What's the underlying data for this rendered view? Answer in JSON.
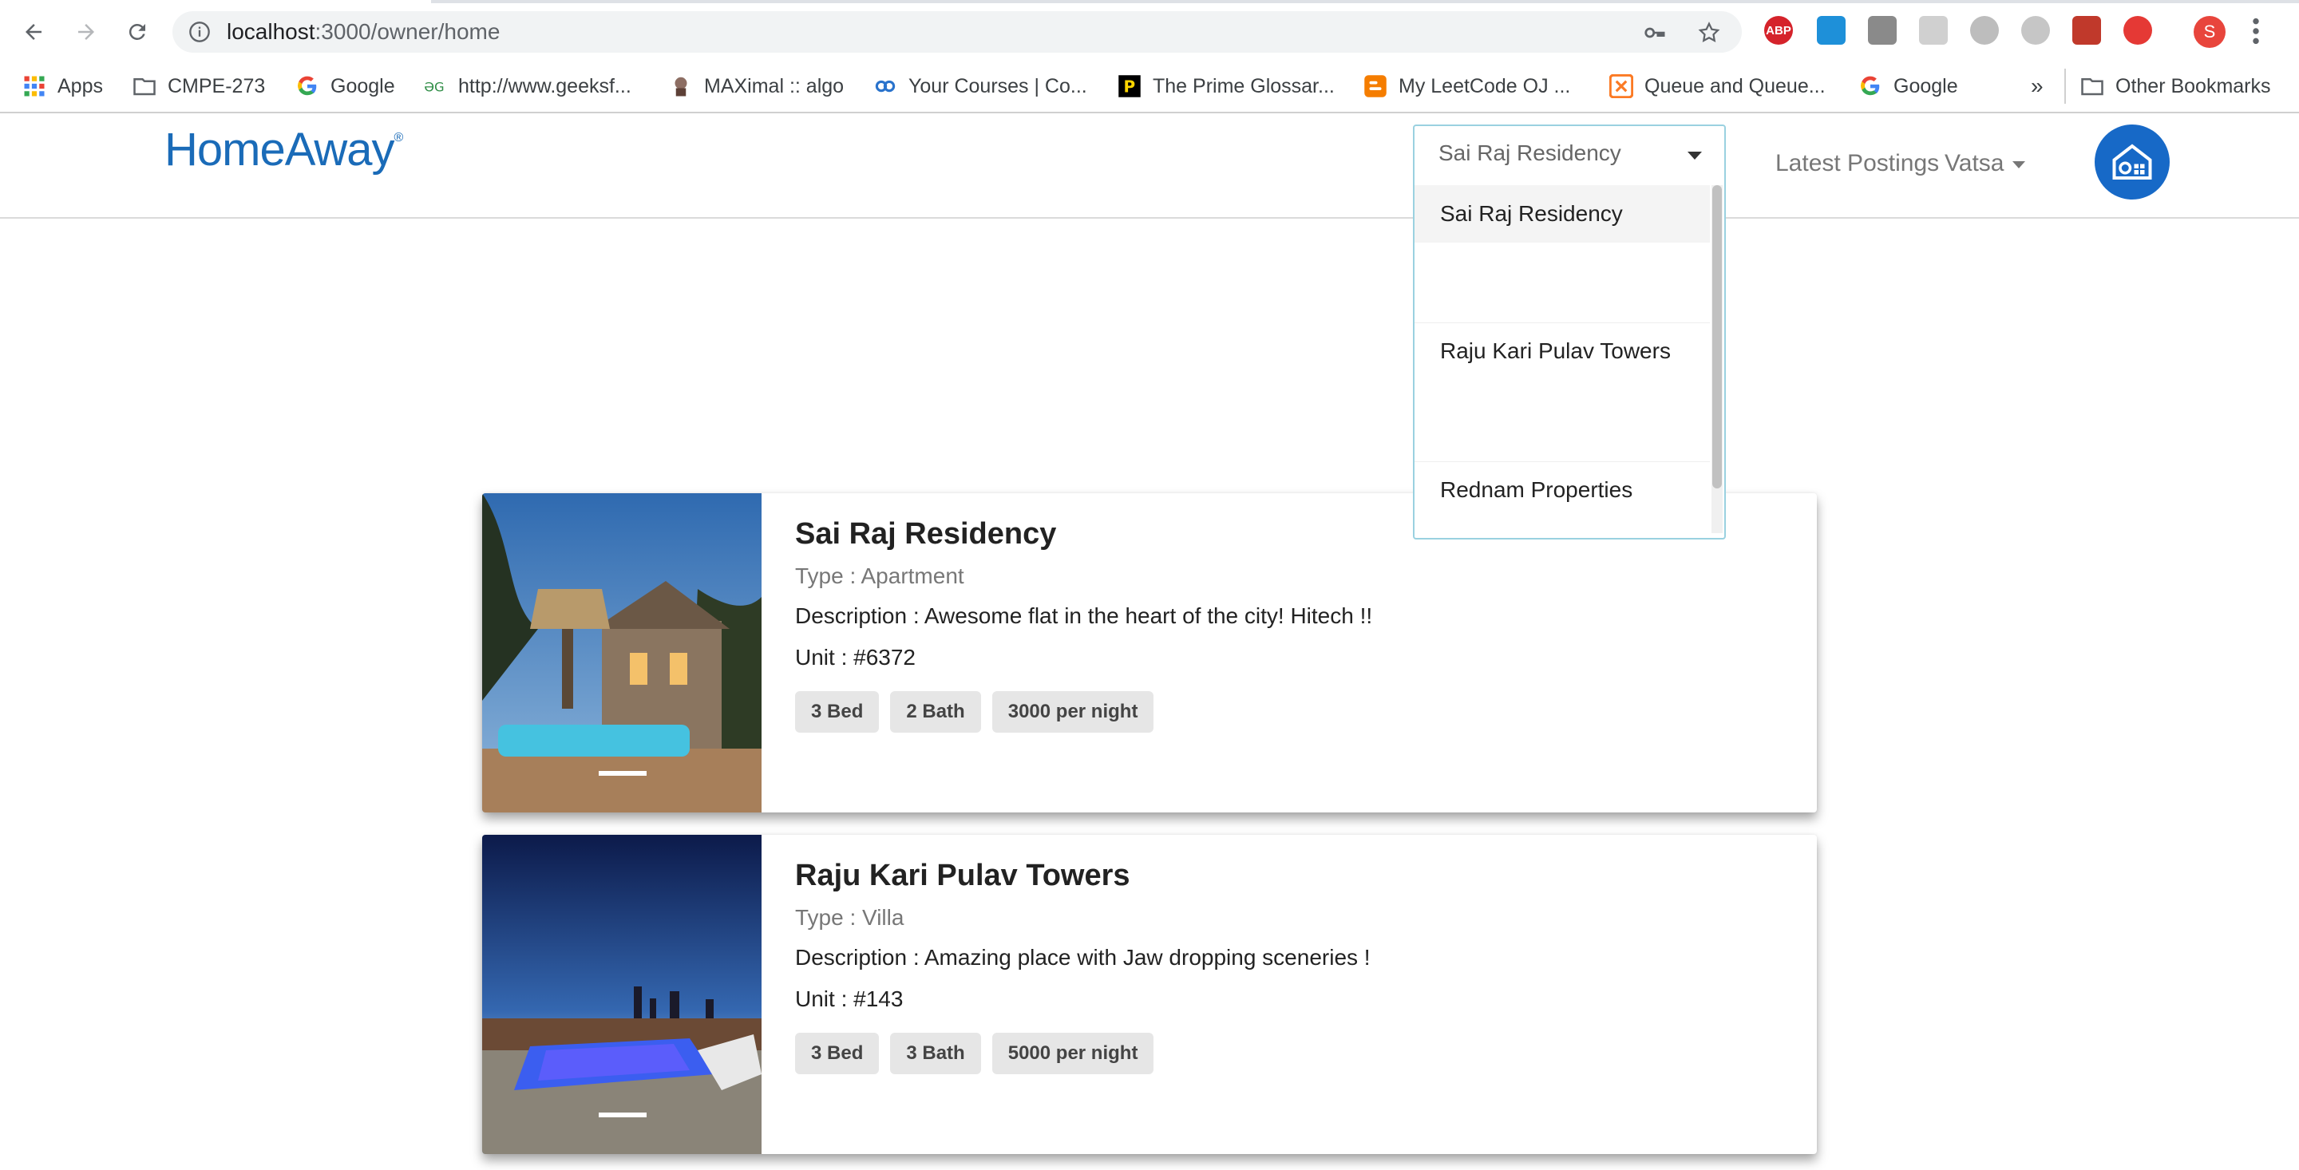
{
  "browser": {
    "url_host": "localhost",
    "url_path": ":3000/owner/home",
    "profile_initial": "S",
    "extensions": [
      "ABP"
    ],
    "bookmarks": [
      {
        "label": "Apps",
        "icon": "apps-grid-icon"
      },
      {
        "label": "CMPE-273",
        "icon": "folder-icon"
      },
      {
        "label": "Google",
        "icon": "google-icon"
      },
      {
        "label": "http://www.geeksf...",
        "icon": "geeksforgeeks-icon"
      },
      {
        "label": "MAXimal :: algo",
        "icon": "maximal-icon"
      },
      {
        "label": "Your Courses | Co...",
        "icon": "coursera-icon"
      },
      {
        "label": "The Prime Glossar...",
        "icon": "prime-glossary-icon"
      },
      {
        "label": "My LeetCode OJ ...",
        "icon": "blogger-icon"
      },
      {
        "label": "Queue and Queue...",
        "icon": "xampp-icon"
      },
      {
        "label": "Google",
        "icon": "google-icon"
      }
    ],
    "overflow_label": "»",
    "other_bookmarks": "Other Bookmarks"
  },
  "app": {
    "logo": "HomeAway",
    "logo_mark": "®",
    "nav": {
      "latest_postings": "Latest Postings",
      "user": "Vatsa"
    },
    "property_select": {
      "selected": "Sai Raj Residency",
      "options": [
        "Sai Raj Residency",
        "Raju Kari Pulav Towers",
        "Rednam Properties"
      ]
    }
  },
  "listings": [
    {
      "title": "Sai Raj Residency",
      "type": "Type : Apartment",
      "description": "Description : Awesome flat in the heart of the city! Hitech !!",
      "unit": "Unit : #6372",
      "beds": "3 Bed",
      "baths": "2 Bath",
      "price": "3000 per night"
    },
    {
      "title": "Raju Kari Pulav Towers",
      "type": "Type : Villa",
      "description": "Description : Amazing place with Jaw dropping sceneries !",
      "unit": "Unit : #143",
      "beds": "3 Bed",
      "baths": "3 Bath",
      "price": "5000 per night"
    }
  ],
  "colors": {
    "brand_blue": "#1a6bb8",
    "home_button": "#1769c7",
    "select_border": "#9ad1e0"
  }
}
